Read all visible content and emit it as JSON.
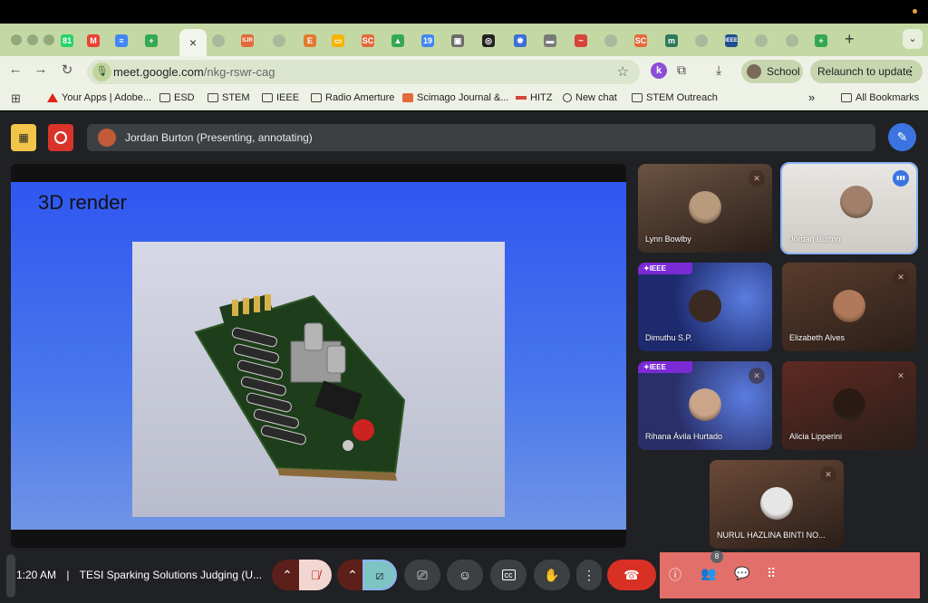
{
  "browser": {
    "tabs_favicons": [
      {
        "icon": "whatsapp-icon",
        "color": "#25d366",
        "glyph": "81"
      },
      {
        "icon": "gmail-icon",
        "color": "#ea4335",
        "glyph": "M"
      },
      {
        "icon": "google-docs-icon",
        "color": "#4285f4",
        "glyph": "≡"
      },
      {
        "icon": "google-sheets-icon",
        "color": "#34a853",
        "glyph": "+"
      },
      {
        "icon": "generic-page-icon",
        "color": "#9aa59a",
        "glyph": ""
      },
      {
        "icon": "sjr-icon",
        "color": "#e36a3b",
        "glyph": "SJR"
      },
      {
        "icon": "generic-page-icon",
        "color": "#9aa59a",
        "glyph": ""
      },
      {
        "icon": "e-icon",
        "color": "#e37a2f",
        "glyph": "E"
      },
      {
        "icon": "slides-icon",
        "color": "#f4b400",
        "glyph": "▭"
      },
      {
        "icon": "sc-icon",
        "color": "#e36a3b",
        "glyph": "SC"
      },
      {
        "icon": "drive-icon",
        "color": "#34a853",
        "glyph": "▲"
      },
      {
        "icon": "calendar-icon",
        "color": "#4285f4",
        "glyph": "19"
      },
      {
        "icon": "photo-icon",
        "color": "#6b6b6b",
        "glyph": "▣"
      },
      {
        "icon": "openai-icon",
        "color": "#222222",
        "glyph": "◎"
      },
      {
        "icon": "gear-icon",
        "color": "#3b6fd6",
        "glyph": "✹"
      },
      {
        "icon": "image-icon",
        "color": "#7a7a7a",
        "glyph": "▬"
      },
      {
        "icon": "hitz-icon",
        "color": "#d6443b",
        "glyph": "~"
      },
      {
        "icon": "generic-page-icon",
        "color": "#9aa59a",
        "glyph": ""
      },
      {
        "icon": "sc-icon",
        "color": "#e36a3b",
        "glyph": "SC"
      },
      {
        "icon": "m-icon",
        "color": "#2c7a5a",
        "glyph": "m"
      },
      {
        "icon": "generic-page-icon",
        "color": "#9aa59a",
        "glyph": ""
      },
      {
        "icon": "ieee-icon",
        "color": "#1f4f8f",
        "glyph": "IEEE"
      },
      {
        "icon": "generic-page-icon",
        "color": "#9aa59a",
        "glyph": ""
      },
      {
        "icon": "generic-page-icon",
        "color": "#9aa59a",
        "glyph": ""
      },
      {
        "icon": "google-sheets-icon",
        "color": "#34a853",
        "glyph": "+"
      }
    ],
    "active_tab_close": "×",
    "new_tab": "+",
    "url_host": "meet.google.com",
    "url_path": "/nkg-rswr-cag",
    "profile_label": "School",
    "relaunch_label": "Relaunch to update",
    "bookmarks": [
      {
        "label": "Your Apps | Adobe...",
        "icon": "adobe-icon"
      },
      {
        "label": "ESD",
        "icon": "folder-icon"
      },
      {
        "label": "STEM",
        "icon": "folder-icon"
      },
      {
        "label": "IEEE",
        "icon": "folder-icon"
      },
      {
        "label": "Radio Amerture",
        "icon": "folder-icon"
      },
      {
        "label": "Scimago Journal &...",
        "icon": "sjr-icon"
      },
      {
        "label": "HITZ",
        "icon": "hitz-icon"
      },
      {
        "label": "New chat",
        "icon": "openai-icon"
      },
      {
        "label": "STEM Outreach",
        "icon": "folder-icon"
      }
    ],
    "all_bookmarks": "All Bookmarks",
    "overflow": "»"
  },
  "meet": {
    "presenter_text": "Jordan Burton (Presenting, annotating)",
    "slide_title": "3D render",
    "participants": [
      {
        "name": "Lynn Bowlby",
        "muted": true,
        "bg": "#6b5342",
        "face": "#b89a7c"
      },
      {
        "name": "Jordan Burton",
        "muted": false,
        "speaking": true,
        "bg": "#cfcac4",
        "face": "#a0806b"
      },
      {
        "name": "Dimuthu S.P.",
        "muted": false,
        "ieee": true,
        "bg": "#1e2a6e",
        "face": "#3a2a22"
      },
      {
        "name": "Elizabeth Alves",
        "muted": true,
        "bg": "#5a3c2c",
        "face": "#b07a5a"
      },
      {
        "name": "Rihana Ávila Hurtado",
        "muted": true,
        "ieee": true,
        "bg": "#2a2f6a",
        "face": "#caa58a"
      },
      {
        "name": "Alicia Lipperini",
        "muted": true,
        "bg": "#5e2a22",
        "face": "#2a1a14"
      },
      {
        "name": "NURUL HAZLINA BINTI NO...",
        "muted": true,
        "bg": "#6b4a38",
        "face": "#e6e6e6"
      }
    ],
    "ieee_badge": "✦IEEE",
    "time": "1:20 AM",
    "separator": "|",
    "meeting_title": "TESI Sparking Solutions Judging (U...",
    "people_count": "8"
  },
  "colors": {
    "accent_blue": "#3b74e0",
    "end_call": "#d93025",
    "muted_bg": "#f2d6d2",
    "camera_bg": "#7fc4c4",
    "panel_red": "#e36f6a"
  }
}
